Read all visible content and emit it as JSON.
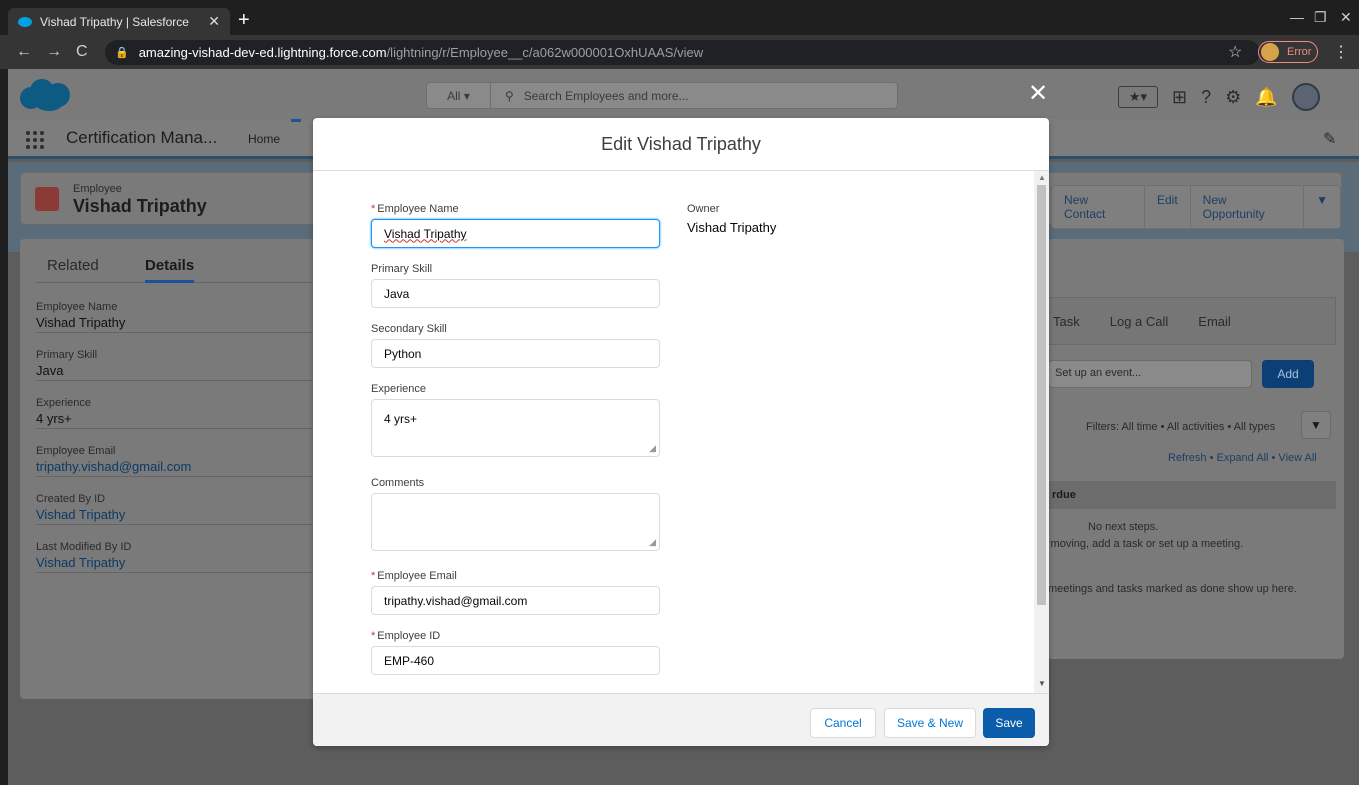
{
  "browser": {
    "tab_title": "Vishad Tripathy | Salesforce",
    "url_host": "amazing-vishad-dev-ed.lightning.force.com",
    "url_path": "/lightning/r/Employee__c/a062w000001OxhUAAS/view",
    "profile_status": "Error"
  },
  "header": {
    "search_scope": "All",
    "search_placeholder": "Search Employees and more..."
  },
  "nav": {
    "app_name": "Certification Mana...",
    "home": "Home",
    "active_tab_fragment": "E"
  },
  "record": {
    "type": "Employee",
    "name": "Vishad Tripathy",
    "actions": [
      "New Contact",
      "Edit",
      "New Opportunity"
    ]
  },
  "detail_tabs": {
    "related": "Related",
    "details": "Details"
  },
  "details": [
    {
      "label": "Employee Name",
      "value": "Vishad Tripathy",
      "link": false
    },
    {
      "label": "Primary Skill",
      "value": "Java",
      "link": false
    },
    {
      "label": "Experience",
      "value": "4 yrs+",
      "link": false
    },
    {
      "label": "Employee Email",
      "value": "tripathy.vishad@gmail.com",
      "link": true
    },
    {
      "label": "Created By ID",
      "value": "Vishad Tripathy",
      "link": true
    },
    {
      "label": "Last Modified By ID",
      "value": "Vishad Tripathy",
      "link": true
    }
  ],
  "activity": {
    "tabs": [
      "Task",
      "Log a Call",
      "Email"
    ],
    "event_placeholder": "Set up an event...",
    "add_label": "Add",
    "filters": "Filters: All time • All activities • All types",
    "refresh_links": "Refresh • Expand All • View All",
    "overdue_label": "rdue",
    "no_next_steps": "No next steps.",
    "moving_hint": "s moving, add a task or set up a meeting.",
    "past_hint": "meetings and tasks marked as done show up here."
  },
  "modal": {
    "title": "Edit Vishad Tripathy",
    "fields": {
      "employee_name": {
        "label": "Employee Name",
        "value": "Vishad Tripathy"
      },
      "primary_skill": {
        "label": "Primary Skill",
        "value": "Java"
      },
      "secondary_skill": {
        "label": "Secondary Skill",
        "value": "Python"
      },
      "experience": {
        "label": "Experience",
        "value": "4 yrs+"
      },
      "comments": {
        "label": "Comments",
        "value": ""
      },
      "employee_email": {
        "label": "Employee Email",
        "value": "tripathy.vishad@gmail.com"
      },
      "employee_id": {
        "label": "Employee ID",
        "value": "EMP-460"
      }
    },
    "owner": {
      "label": "Owner",
      "value": "Vishad Tripathy"
    },
    "buttons": {
      "cancel": "Cancel",
      "save_new": "Save & New",
      "save": "Save"
    }
  }
}
